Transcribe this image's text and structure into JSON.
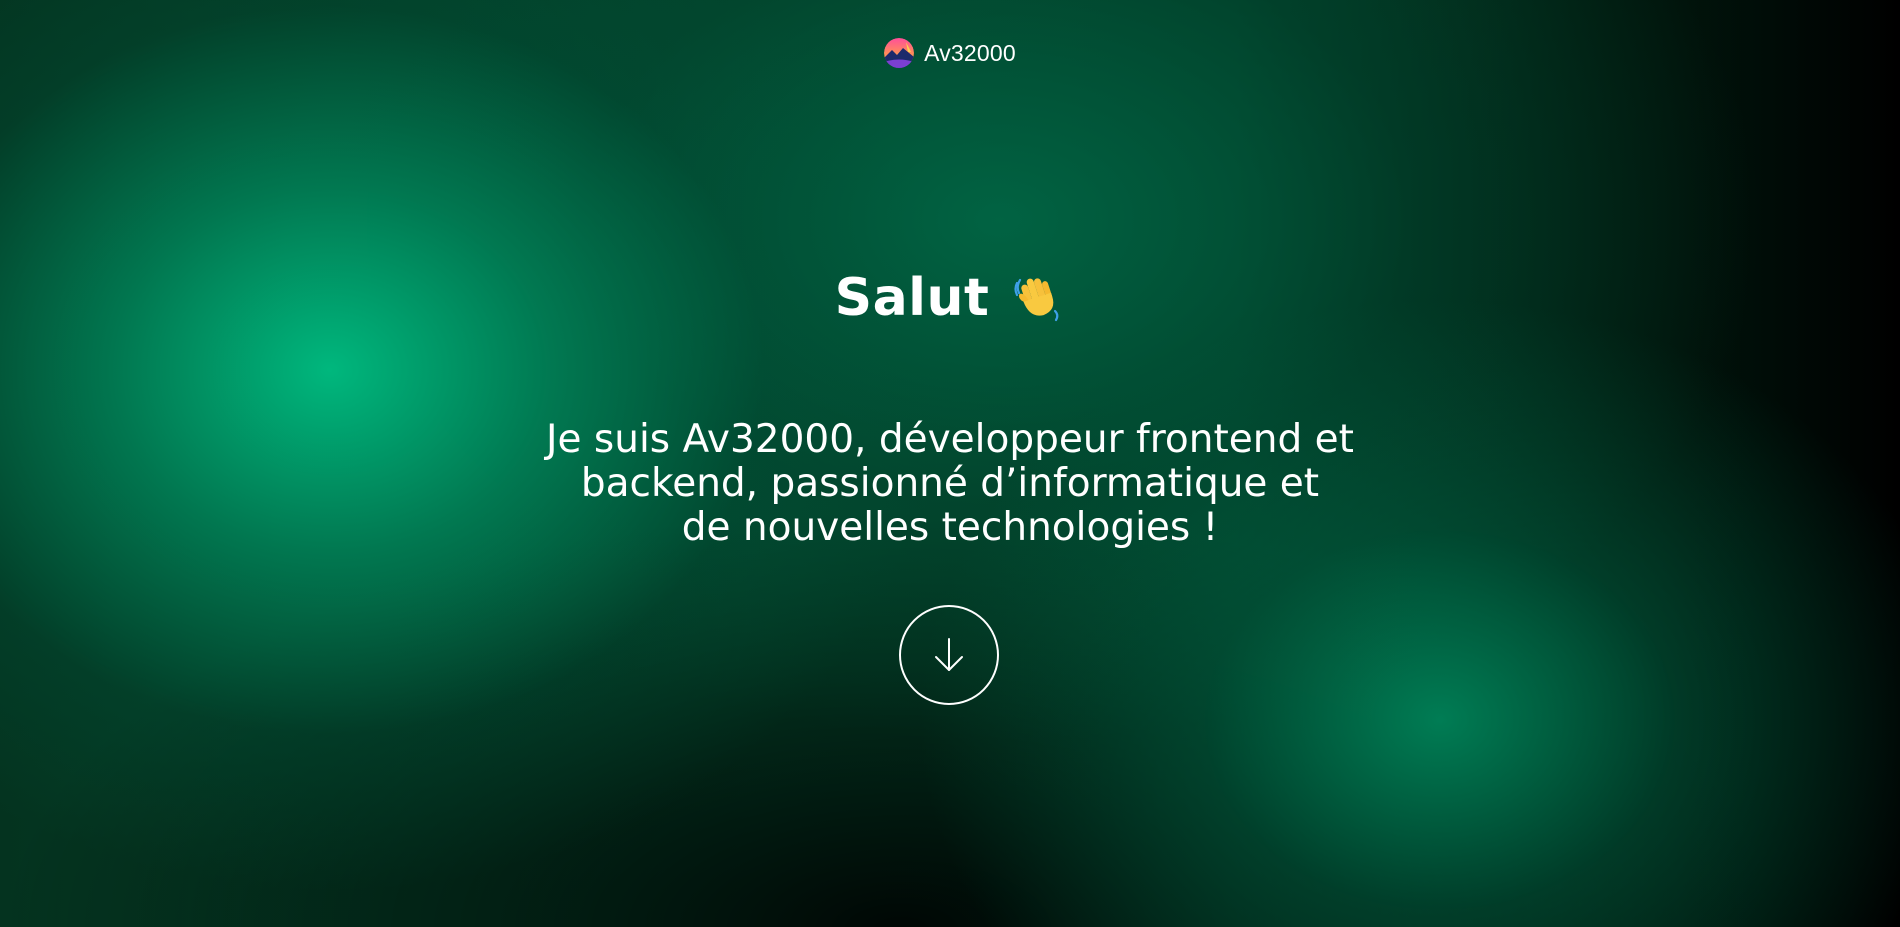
{
  "brand": {
    "name": "Av32000",
    "logo_icon": "avatar-sunset-icon"
  },
  "hero": {
    "greeting": "Salut",
    "greeting_icon": "waving-hand-icon",
    "intro_lines": [
      "Je suis Av32000, développeur frontend et",
      "backend, passionné d’informatique et",
      "de nouvelles technologies !"
    ],
    "scroll_icon": "arrow-down-icon"
  },
  "colors": {
    "accent_green": "#00b97f",
    "text": "#ffffff",
    "background_dark": "#000000"
  }
}
